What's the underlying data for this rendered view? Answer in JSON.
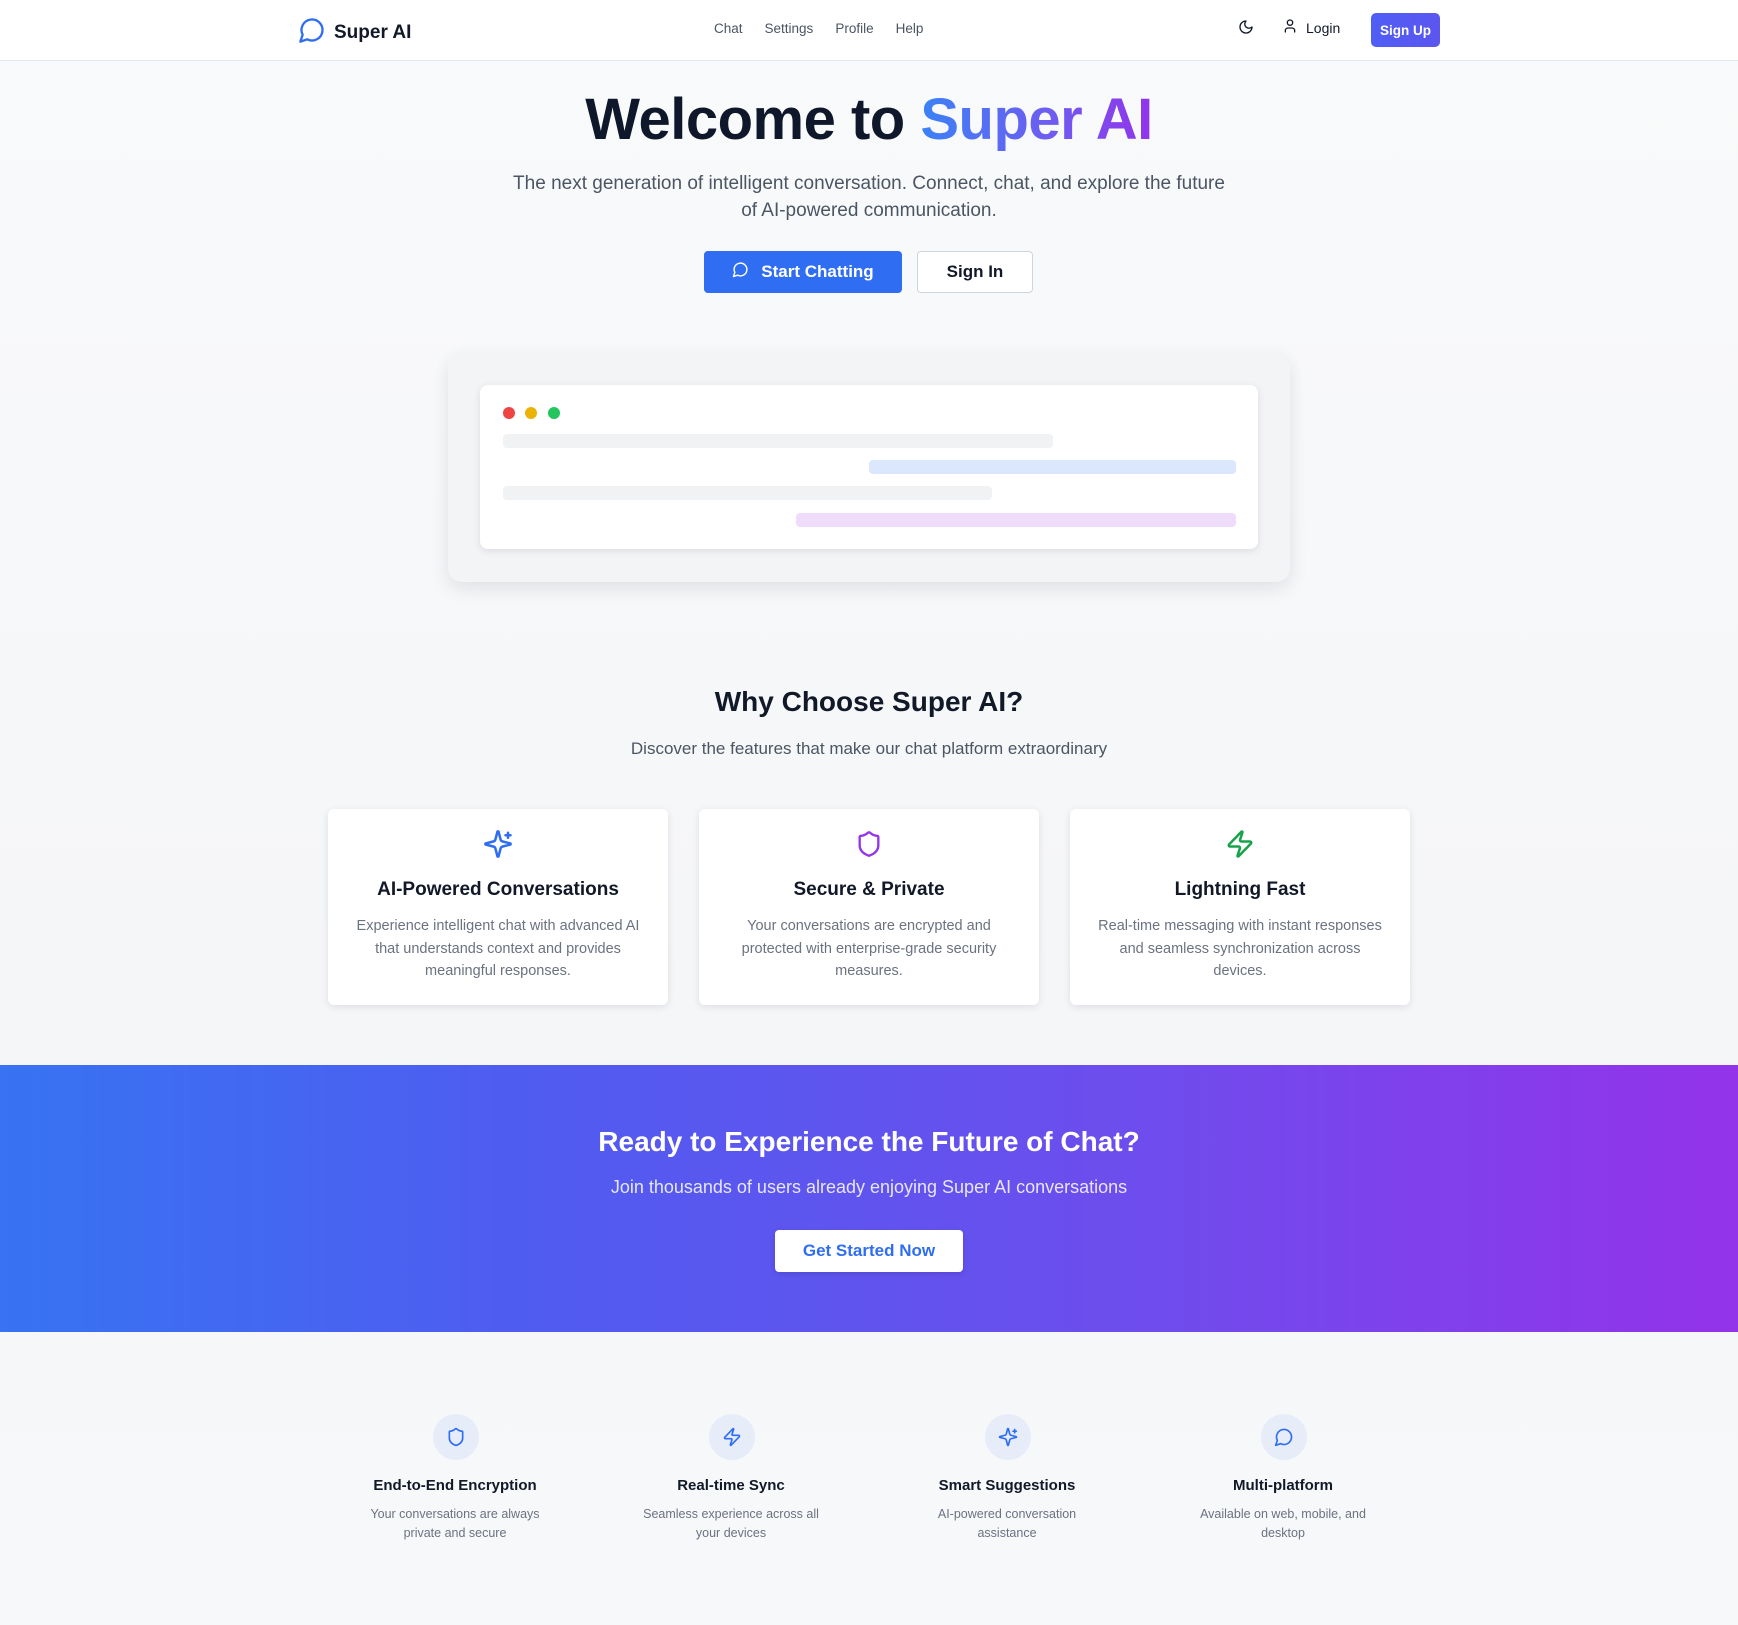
{
  "nav": {
    "brand": "Super AI",
    "links": [
      "Chat",
      "Settings",
      "Profile",
      "Help"
    ],
    "login": "Login",
    "signup": "Sign Up"
  },
  "hero": {
    "title_plain": "Welcome to ",
    "title_accent": "Super AI",
    "subtitle": "The next generation of intelligent conversation. Connect, chat, and explore the future of AI-powered communication.",
    "primary_cta": "Start Chatting",
    "secondary_cta": "Sign In"
  },
  "features": {
    "title": "Why Choose Super AI?",
    "subtitle": "Discover the features that make our chat platform extraordinary",
    "cards": [
      {
        "icon": "sparkles-icon",
        "title": "AI-Powered Conversations",
        "desc": "Experience intelligent chat with advanced AI that understands context and provides meaningful responses."
      },
      {
        "icon": "shield-icon",
        "title": "Secure & Private",
        "desc": "Your conversations are encrypted and protected with enterprise-grade security measures."
      },
      {
        "icon": "lightning-icon",
        "title": "Lightning Fast",
        "desc": "Real-time messaging with instant responses and seamless synchronization across devices."
      }
    ]
  },
  "cta_band": {
    "title": "Ready to Experience the Future of Chat?",
    "subtitle": "Join thousands of users already enjoying Super AI conversations",
    "button": "Get Started Now"
  },
  "highlights": [
    {
      "icon": "shield-icon",
      "title": "End-to-End Encryption",
      "desc": "Your conversations are always private and secure"
    },
    {
      "icon": "lightning-icon",
      "title": "Real-time Sync",
      "desc": "Seamless experience across all your devices"
    },
    {
      "icon": "sparkles-icon",
      "title": "Smart Suggestions",
      "desc": "AI-powered conversation assistance"
    },
    {
      "icon": "chat-bubble-icon",
      "title": "Multi-platform",
      "desc": "Available on web, mobile, and desktop"
    }
  ],
  "colors": {
    "primary": "#2f6ef2",
    "accent_purple": "#9333ea",
    "shield_purple": "#9333ea",
    "lightning_green": "#16a34a"
  }
}
